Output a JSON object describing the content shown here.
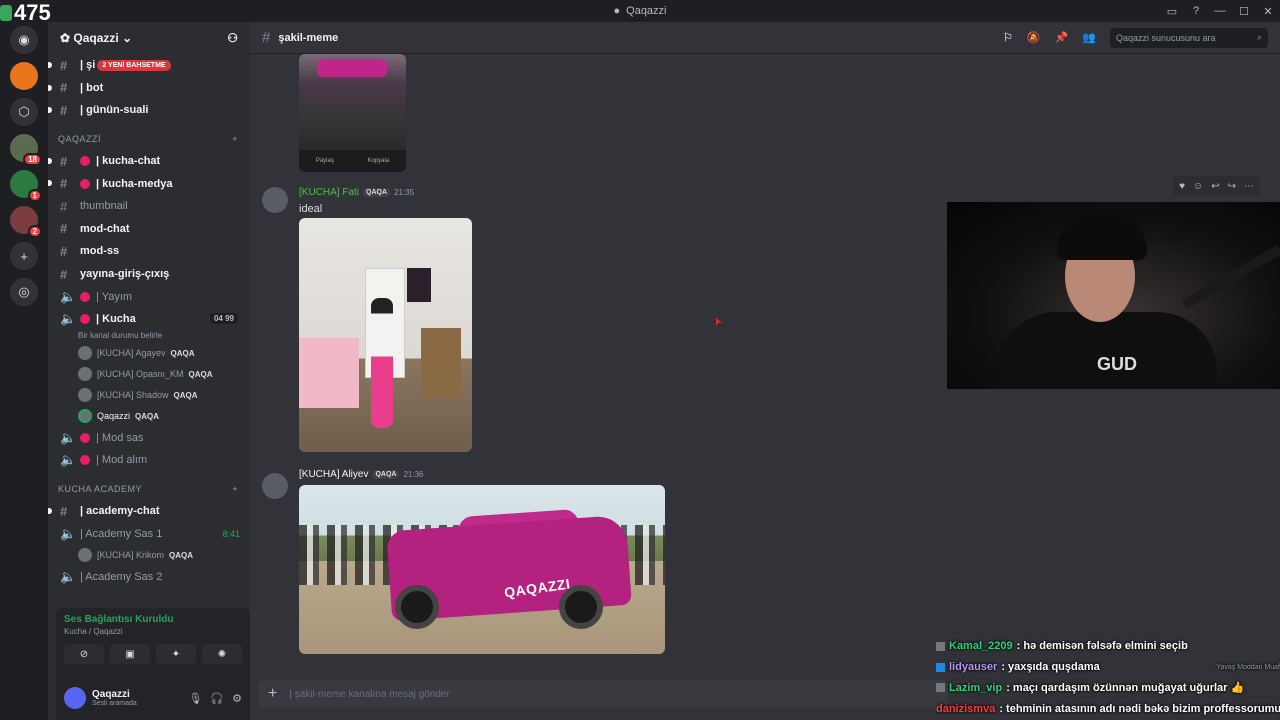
{
  "viewer_count": "475",
  "window_title": "Qaqazzi",
  "guild": {
    "name": "Qaqazzi"
  },
  "guilds_badges": [
    "18",
    "1",
    "2"
  ],
  "channels": {
    "top": [
      {
        "label": "| şi",
        "badge": "2 YENİ BAHSETME"
      },
      {
        "label": "| bot"
      },
      {
        "label": "| günün-suali"
      }
    ],
    "category1": "QAQAZZİ",
    "cat1_items": [
      {
        "label": "| kucha-chat"
      },
      {
        "label": "| kucha-medya"
      },
      {
        "label": "thumbnail"
      },
      {
        "label": "mod-chat"
      },
      {
        "label": "mod-ss"
      },
      {
        "label": "yayına-giriş-çıxış"
      },
      {
        "label": "| Yayım"
      }
    ],
    "kucha_voice": {
      "label": "| Kucha",
      "counter_a": "04",
      "counter_b": "99",
      "status": "Bir kanal durumu belirle"
    },
    "voice_users": [
      {
        "name": "[KUCHA] Agayev",
        "tag": "QAQA"
      },
      {
        "name": "[KUCHA] Opasnı_KM",
        "tag": "QAQA"
      },
      {
        "name": "[KUCHA] Shadow",
        "tag": "QAQA"
      },
      {
        "name": "Qaqazzi",
        "tag": "QAQA"
      }
    ],
    "cat1_after": [
      {
        "label": "| Mod sas"
      },
      {
        "label": "| Mod alım"
      }
    ],
    "category2": "KUCHA ACADEMY",
    "cat2_items": [
      {
        "label": "| academy-chat"
      }
    ],
    "academy_voice": {
      "label": "| Academy Sas 1",
      "time": "8:41"
    },
    "academy_user": {
      "name": "[KUCHA] Krikom",
      "tag": "QAQA"
    },
    "academy_voice2": {
      "label": "| Academy Sas 2"
    }
  },
  "voice_panel": {
    "title": "Ses Bağlantısı Kuruldu",
    "sub": "Kucha / Qaqazzi"
  },
  "user_panel": {
    "name": "Qaqazzi",
    "status": "Sesli aramada"
  },
  "header": {
    "channel": "şakil-meme",
    "search_placeholder": "Qaqazzi sunucusunu ara"
  },
  "phone_image_bar": [
    "Paylaş",
    "Kopyala"
  ],
  "messages": [
    {
      "name": "[KUCHA] Fati",
      "tag": "QAQA",
      "time": "21:35",
      "text": "ideal"
    },
    {
      "name": "[KUCHA] Aliyev",
      "tag": "QAQA",
      "time": "21:36",
      "image_label": "QAQAZZI"
    }
  ],
  "composer_placeholder": "| şakil-meme kanalına mesaj gönder",
  "webcam_shirt": "GUD",
  "chat": [
    {
      "user": "Kamal_2209",
      "text": ": hə demisən fəlsəfə elmini seçib"
    },
    {
      "user": "lidyauser",
      "text": ": yaxşıda quşdama",
      "note": "Yavaş Moddan Muaf"
    },
    {
      "user": "Lazim_vip",
      "text": ": maçı qardaşım özünnən muğayat uğurlar 👍"
    },
    {
      "user": "danizismva",
      "text": ": tehminin atasının adı nədi bəkə bizim proffessorumuz"
    }
  ],
  "colors": {
    "accent_green": "#23a55a",
    "mention_red": "#da373c",
    "car_pink": "#b3227f"
  }
}
